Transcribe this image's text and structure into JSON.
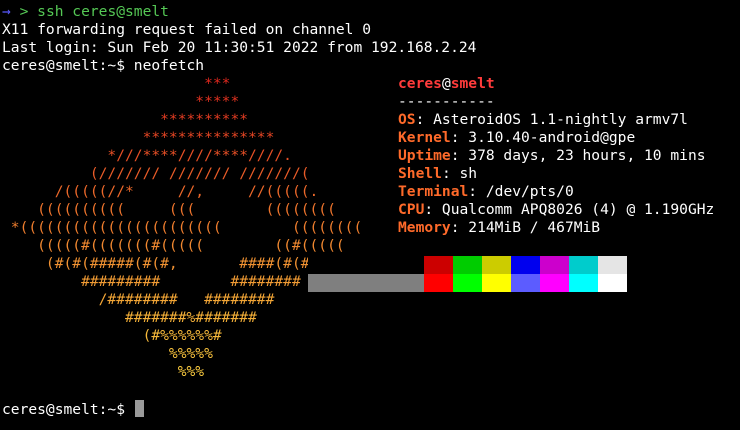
{
  "terminal": {
    "lines": {
      "ssh_arrow": "→",
      "ssh_gt": " > ",
      "ssh_cmd": "ssh ceres@smelt",
      "x11_warning": "X11 forwarding request failed on channel 0",
      "last_login": "Last login: Sun Feb 20 11:30:51 2022 from 192.168.2.24",
      "neofetch_cmd": "ceres@smelt:~$ neofetch",
      "final_prompt": "ceres@smelt:~$ "
    },
    "ascii_logo": [
      {
        "text": "                       ***",
        "color": "#e0281e"
      },
      {
        "text": "                      *****",
        "color": "#e23220"
      },
      {
        "text": "                  **********",
        "color": "#e43c22"
      },
      {
        "text": "                ***************",
        "color": "#e64624"
      },
      {
        "text": "            *///****////****////.",
        "color": "#e85026"
      },
      {
        "text": "          (/////// /////// ///////(",
        "color": "#ea5c28"
      },
      {
        "text": "      /(((((//*     //,     //(((((.",
        "color": "#ec682a"
      },
      {
        "text": "    ((((((((((     (((        ((((((((",
        "color": "#ee742c"
      },
      {
        "text": " *(((((((((((((((((((((((        ((((((((",
        "color": "#ef7e2e"
      },
      {
        "text": "    (((((#(((((((#(((((        ((#(((((",
        "color": "#f08830"
      },
      {
        "text": "     (#(#(#####(#(#,       ####(#(#",
        "color": "#f19232"
      },
      {
        "text": "         #########        ########",
        "color": "#f29c34"
      },
      {
        "text": "           /########   ########",
        "color": "#f3a636"
      },
      {
        "text": "              #######%#######",
        "color": "#f4b038"
      },
      {
        "text": "                (#%%%%%%#",
        "color": "#f5b83a"
      },
      {
        "text": "                   %%%%%",
        "color": "#f6c03c"
      },
      {
        "text": "                    %%%",
        "color": "#f7c83e"
      }
    ],
    "info": {
      "user": "ceres",
      "at": "@",
      "host": "smelt",
      "separator": "-----------",
      "rows": [
        {
          "key": "OS",
          "value": ": AsteroidOS 1.1-nightly armv7l"
        },
        {
          "key": "Kernel",
          "value": ": 3.10.40-android@gpe"
        },
        {
          "key": "Uptime",
          "value": ": 378 days, 23 hours, 10 mins"
        },
        {
          "key": "Shell",
          "value": ": sh"
        },
        {
          "key": "Terminal",
          "value": ": /dev/pts/0"
        },
        {
          "key": "CPU",
          "value": ": Qualcomm APQ8026 (4) @ 1.190GHz"
        },
        {
          "key": "Memory",
          "value": ": 214MiB / 467MiB"
        }
      ]
    },
    "palette": {
      "row1": [
        "#000000",
        "#000000",
        "#000000",
        "#000000",
        "#cc0000",
        "#00cc00",
        "#cccc00",
        "#0000ee",
        "#cc00cc",
        "#00cccc",
        "#e5e5e5"
      ],
      "row2": [
        "#7f7f7f",
        "#7f7f7f",
        "#7f7f7f",
        "#7f7f7f",
        "#ff0000",
        "#00ff00",
        "#ffff00",
        "#5c5cff",
        "#ff00ff",
        "#00ffff",
        "#ffffff"
      ]
    },
    "colors": {
      "background": "#000000",
      "foreground": "#ffffff",
      "key": "#ff6a2a",
      "userhost": "#ff3b3b",
      "prompt_green": "#55c855",
      "prompt_blue": "#5a5aff",
      "cursor": "#9a9a9a"
    }
  }
}
